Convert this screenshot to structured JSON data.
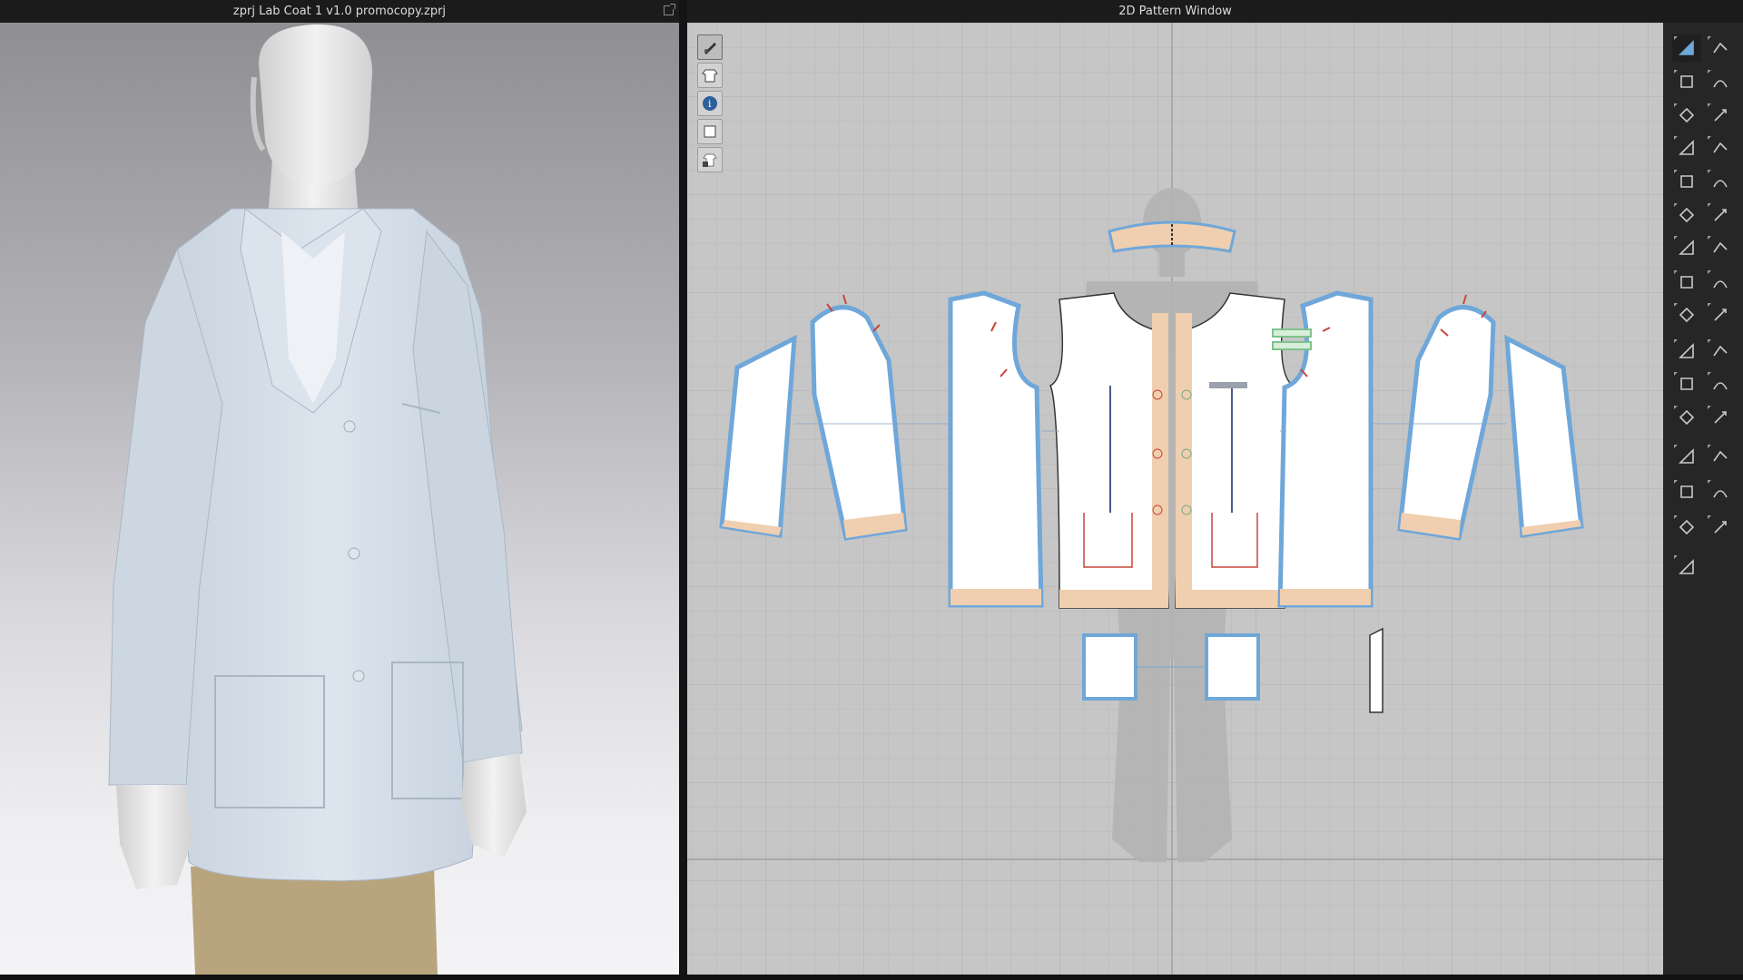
{
  "window_3d": {
    "title": "zprj Lab Coat 1 v1.0 promocopy.zprj"
  },
  "window_2d": {
    "title": "2D Pattern Window"
  },
  "colors": {
    "accent_blue": "#6fa7d9",
    "seam_red": "#c9463a",
    "facing_peach": "#efcfaf",
    "trim_green": "#7fc38c",
    "pattern_bg": "#c6c6c6"
  },
  "left_tools": [
    {
      "icon": "show-avatar-icon",
      "active": true
    },
    {
      "icon": "show-garment-icon",
      "active": false
    },
    {
      "icon": "info-icon",
      "active": false
    },
    {
      "icon": "pattern-piece-icon",
      "active": false
    },
    {
      "icon": "lock-garment-icon",
      "active": false
    }
  ],
  "right_tools": [
    {
      "icon": "transform-pattern-icon",
      "active": true
    },
    {
      "icon": "transform-mesh-icon",
      "active": false
    },
    {
      "icon": "edit-pattern-icon",
      "active": false
    },
    {
      "icon": "edit-curvature-icon",
      "active": false
    },
    {
      "icon": "polygon-icon",
      "active": false
    },
    {
      "icon": "add-point-icon",
      "active": false
    },
    {
      "icon": "rectangle-icon",
      "active": false
    },
    {
      "icon": "edit-sewing-icon",
      "active": false
    },
    {
      "icon": "internal-polygon-icon",
      "active": false
    },
    {
      "icon": "segment-sewing-icon",
      "active": false
    },
    {
      "icon": "internal-rectangle-icon",
      "active": false
    },
    {
      "icon": "free-sewing-icon",
      "active": false
    },
    {
      "icon": "dart-icon",
      "active": false
    },
    {
      "icon": "tack-icon",
      "active": false
    },
    {
      "icon": "trace-icon",
      "active": false
    },
    {
      "icon": "fold-icon",
      "active": false
    },
    {
      "icon": "pleat-icon",
      "active": false
    },
    {
      "icon": "zipper-icon",
      "active": false
    },
    {
      "icon": "seam-allowance-icon",
      "active": false
    },
    {
      "icon": "button-icon",
      "active": false
    },
    {
      "icon": "tape-icon",
      "active": false
    },
    {
      "icon": "buttonhole-icon",
      "active": false
    },
    {
      "icon": "topstitch-icon",
      "active": false
    },
    {
      "icon": "annotation-icon",
      "active": false
    },
    {
      "icon": "text-icon",
      "active": false
    },
    {
      "icon": "grainline-icon",
      "active": false
    },
    {
      "icon": "puckering-icon",
      "active": false
    },
    {
      "icon": "symmetry-icon",
      "active": false
    },
    {
      "icon": "material-icon",
      "active": false
    },
    {
      "icon": "layer-icon",
      "active": false
    },
    {
      "icon": "avatar-measure-icon",
      "active": false
    }
  ]
}
